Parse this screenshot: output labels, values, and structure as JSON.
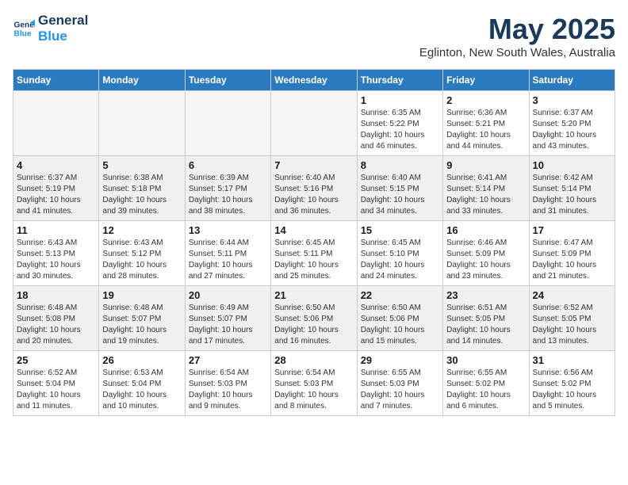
{
  "header": {
    "logo_line1": "General",
    "logo_line2": "Blue",
    "month": "May 2025",
    "location": "Eglinton, New South Wales, Australia"
  },
  "weekdays": [
    "Sunday",
    "Monday",
    "Tuesday",
    "Wednesday",
    "Thursday",
    "Friday",
    "Saturday"
  ],
  "weeks": [
    [
      {
        "day": "",
        "info": ""
      },
      {
        "day": "",
        "info": ""
      },
      {
        "day": "",
        "info": ""
      },
      {
        "day": "",
        "info": ""
      },
      {
        "day": "1",
        "info": "Sunrise: 6:35 AM\nSunset: 5:22 PM\nDaylight: 10 hours\nand 46 minutes."
      },
      {
        "day": "2",
        "info": "Sunrise: 6:36 AM\nSunset: 5:21 PM\nDaylight: 10 hours\nand 44 minutes."
      },
      {
        "day": "3",
        "info": "Sunrise: 6:37 AM\nSunset: 5:20 PM\nDaylight: 10 hours\nand 43 minutes."
      }
    ],
    [
      {
        "day": "4",
        "info": "Sunrise: 6:37 AM\nSunset: 5:19 PM\nDaylight: 10 hours\nand 41 minutes."
      },
      {
        "day": "5",
        "info": "Sunrise: 6:38 AM\nSunset: 5:18 PM\nDaylight: 10 hours\nand 39 minutes."
      },
      {
        "day": "6",
        "info": "Sunrise: 6:39 AM\nSunset: 5:17 PM\nDaylight: 10 hours\nand 38 minutes."
      },
      {
        "day": "7",
        "info": "Sunrise: 6:40 AM\nSunset: 5:16 PM\nDaylight: 10 hours\nand 36 minutes."
      },
      {
        "day": "8",
        "info": "Sunrise: 6:40 AM\nSunset: 5:15 PM\nDaylight: 10 hours\nand 34 minutes."
      },
      {
        "day": "9",
        "info": "Sunrise: 6:41 AM\nSunset: 5:14 PM\nDaylight: 10 hours\nand 33 minutes."
      },
      {
        "day": "10",
        "info": "Sunrise: 6:42 AM\nSunset: 5:14 PM\nDaylight: 10 hours\nand 31 minutes."
      }
    ],
    [
      {
        "day": "11",
        "info": "Sunrise: 6:43 AM\nSunset: 5:13 PM\nDaylight: 10 hours\nand 30 minutes."
      },
      {
        "day": "12",
        "info": "Sunrise: 6:43 AM\nSunset: 5:12 PM\nDaylight: 10 hours\nand 28 minutes."
      },
      {
        "day": "13",
        "info": "Sunrise: 6:44 AM\nSunset: 5:11 PM\nDaylight: 10 hours\nand 27 minutes."
      },
      {
        "day": "14",
        "info": "Sunrise: 6:45 AM\nSunset: 5:11 PM\nDaylight: 10 hours\nand 25 minutes."
      },
      {
        "day": "15",
        "info": "Sunrise: 6:45 AM\nSunset: 5:10 PM\nDaylight: 10 hours\nand 24 minutes."
      },
      {
        "day": "16",
        "info": "Sunrise: 6:46 AM\nSunset: 5:09 PM\nDaylight: 10 hours\nand 23 minutes."
      },
      {
        "day": "17",
        "info": "Sunrise: 6:47 AM\nSunset: 5:09 PM\nDaylight: 10 hours\nand 21 minutes."
      }
    ],
    [
      {
        "day": "18",
        "info": "Sunrise: 6:48 AM\nSunset: 5:08 PM\nDaylight: 10 hours\nand 20 minutes."
      },
      {
        "day": "19",
        "info": "Sunrise: 6:48 AM\nSunset: 5:07 PM\nDaylight: 10 hours\nand 19 minutes."
      },
      {
        "day": "20",
        "info": "Sunrise: 6:49 AM\nSunset: 5:07 PM\nDaylight: 10 hours\nand 17 minutes."
      },
      {
        "day": "21",
        "info": "Sunrise: 6:50 AM\nSunset: 5:06 PM\nDaylight: 10 hours\nand 16 minutes."
      },
      {
        "day": "22",
        "info": "Sunrise: 6:50 AM\nSunset: 5:06 PM\nDaylight: 10 hours\nand 15 minutes."
      },
      {
        "day": "23",
        "info": "Sunrise: 6:51 AM\nSunset: 5:05 PM\nDaylight: 10 hours\nand 14 minutes."
      },
      {
        "day": "24",
        "info": "Sunrise: 6:52 AM\nSunset: 5:05 PM\nDaylight: 10 hours\nand 13 minutes."
      }
    ],
    [
      {
        "day": "25",
        "info": "Sunrise: 6:52 AM\nSunset: 5:04 PM\nDaylight: 10 hours\nand 11 minutes."
      },
      {
        "day": "26",
        "info": "Sunrise: 6:53 AM\nSunset: 5:04 PM\nDaylight: 10 hours\nand 10 minutes."
      },
      {
        "day": "27",
        "info": "Sunrise: 6:54 AM\nSunset: 5:03 PM\nDaylight: 10 hours\nand 9 minutes."
      },
      {
        "day": "28",
        "info": "Sunrise: 6:54 AM\nSunset: 5:03 PM\nDaylight: 10 hours\nand 8 minutes."
      },
      {
        "day": "29",
        "info": "Sunrise: 6:55 AM\nSunset: 5:03 PM\nDaylight: 10 hours\nand 7 minutes."
      },
      {
        "day": "30",
        "info": "Sunrise: 6:55 AM\nSunset: 5:02 PM\nDaylight: 10 hours\nand 6 minutes."
      },
      {
        "day": "31",
        "info": "Sunrise: 6:56 AM\nSunset: 5:02 PM\nDaylight: 10 hours\nand 5 minutes."
      }
    ]
  ]
}
